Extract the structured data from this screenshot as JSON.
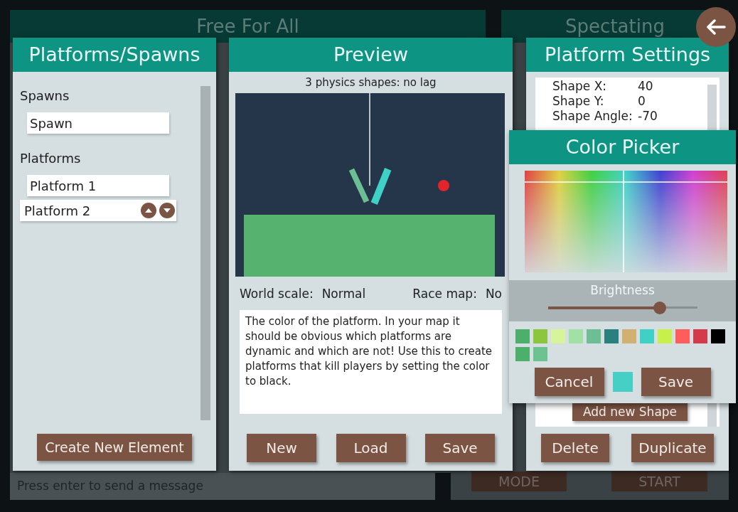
{
  "background": {
    "left_title": "Free For All",
    "right_title": "Spectating",
    "chat_placeholder": "Press enter to send a message",
    "mode_button": "MODE",
    "start_button": "START"
  },
  "platforms_panel": {
    "title": "Platforms/Spawns",
    "sections": [
      {
        "label": "Spawns",
        "items": [
          {
            "name": "Spawn",
            "selected": false
          }
        ]
      },
      {
        "label": "Platforms",
        "items": [
          {
            "name": "Platform 1",
            "selected": false
          },
          {
            "name": "Platform 2",
            "selected": true
          }
        ]
      }
    ],
    "create_button": "Create New Element"
  },
  "preview_panel": {
    "title": "Preview",
    "status": "3 physics shapes: no lag",
    "world_scale_label": "World scale:",
    "world_scale": "Normal",
    "race_map_label": "Race map:",
    "race_map": "No",
    "description": "The color of the platform. In your map it should be obvious which platforms are dynamic and which are not! Use this to create platforms that kill players by setting the color to black.",
    "buttons": [
      "New",
      "Load",
      "Save"
    ]
  },
  "settings_panel": {
    "title": "Platform Settings",
    "properties": [
      {
        "label": "Shape X:",
        "value": "40"
      },
      {
        "label": "Shape Y:",
        "value": "0"
      },
      {
        "label": "Shape Angle:",
        "value": "-70"
      }
    ],
    "add_shape_button": "Add new Shape",
    "buttons": [
      "Delete",
      "Duplicate"
    ]
  },
  "color_picker": {
    "title": "Color Picker",
    "brightness_label": "Brightness",
    "brightness": {
      "level": 0.75
    },
    "swatches": [
      {
        "color": "#4caf6a"
      },
      {
        "color": "#8cc63f"
      },
      {
        "color": "#d6f59a"
      },
      {
        "color": "#a3e0a6"
      },
      {
        "color": "#6cbf94"
      },
      {
        "color": "#2a7f7f"
      },
      {
        "color": "#d2b071"
      },
      {
        "color": "#3fd0c6"
      },
      {
        "color": "#c8f04a"
      },
      {
        "color": "#ff5c5c"
      },
      {
        "color": "#d43a4a"
      },
      {
        "color": "#000000"
      },
      {
        "color": "#4caf6a"
      },
      {
        "color": "#6cc291"
      }
    ],
    "current": {
      "color": "#46d0c5"
    },
    "cancel_button": "Cancel",
    "save_button": "Save"
  }
}
